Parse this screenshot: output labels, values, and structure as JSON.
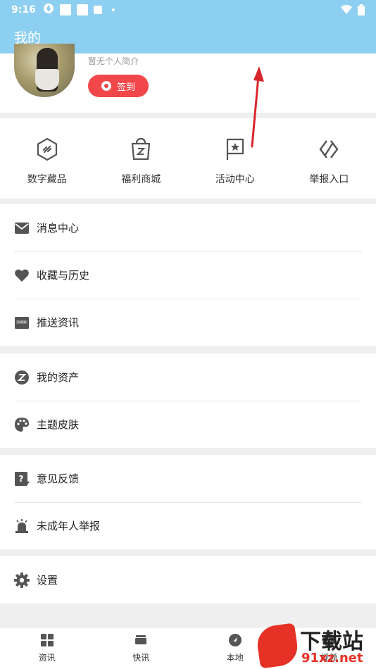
{
  "status_bar": {
    "time": "9:16"
  },
  "app_bar": {
    "title": "我的"
  },
  "profile": {
    "bio": "暂无个人简介",
    "signin_label": "签到"
  },
  "quick_actions": [
    {
      "label": "数字藏品",
      "icon": "digital-collection-icon"
    },
    {
      "label": "福利商城",
      "icon": "shopping-bag-icon"
    },
    {
      "label": "活动中心",
      "icon": "flag-star-icon"
    },
    {
      "label": "举报入口",
      "icon": "report-icon"
    }
  ],
  "menu_groups": [
    [
      {
        "label": "消息中心",
        "icon": "mail-icon"
      },
      {
        "label": "收藏与历史",
        "icon": "heart-icon"
      },
      {
        "label": "推送资讯",
        "icon": "push-icon"
      }
    ],
    [
      {
        "label": "我的资产",
        "icon": "z-coin-icon"
      },
      {
        "label": "主题皮肤",
        "icon": "palette-icon"
      }
    ],
    [
      {
        "label": "意见反馈",
        "icon": "feedback-icon"
      },
      {
        "label": "未成年人举报",
        "icon": "alarm-icon"
      }
    ],
    [
      {
        "label": "设置",
        "icon": "gear-icon"
      }
    ]
  ],
  "tab_bar": [
    {
      "label": "资讯",
      "icon": "grid-icon"
    },
    {
      "label": "快讯",
      "icon": "tv-icon"
    },
    {
      "label": "本地",
      "icon": "compass-icon"
    },
    {
      "label": "视频",
      "icon": "play-icon"
    }
  ],
  "watermark": {
    "text": "下载站",
    "url": "91xz.net"
  },
  "colors": {
    "header": "#8dcff0",
    "accent": "#f2474a",
    "icon": "#555555"
  }
}
